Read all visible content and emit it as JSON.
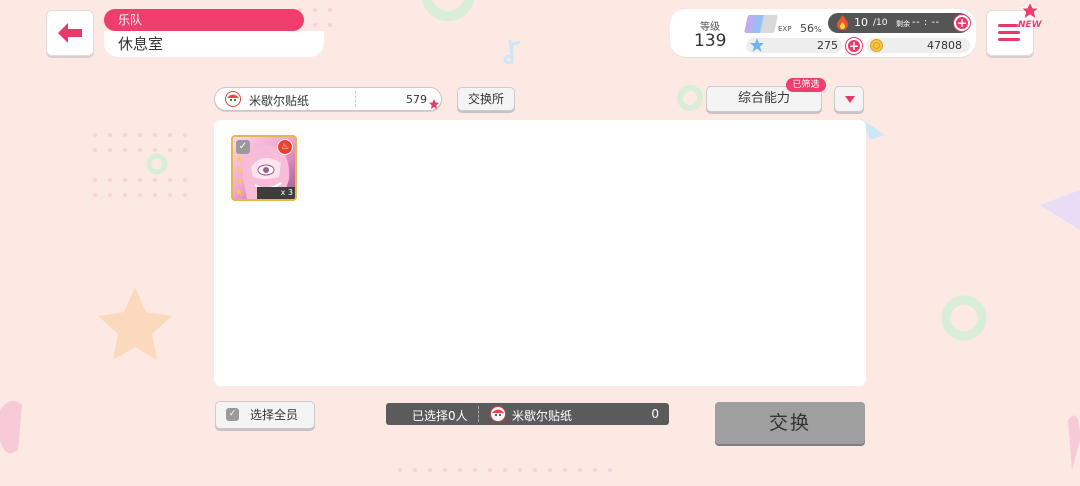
{
  "header": {
    "location_tag": "乐队",
    "location_name": "休息室"
  },
  "status": {
    "level_label": "等级",
    "level": "139",
    "exp_label": "EXP",
    "exp_percent": "56",
    "exp_unit": "%",
    "stamina_current": "10",
    "stamina_max": "/10",
    "stamina_remain_label": "剩余",
    "stamina_remain": "-- : --",
    "stars": "275",
    "coins": "47808"
  },
  "new_badge": "NEW",
  "toolbar": {
    "currency_name": "米歇尔贴纸",
    "currency_amount": "579",
    "exchange_shop_label": "交换所",
    "sort_label": "综合能力",
    "filtered_badge": "已筛选"
  },
  "cards": [
    {
      "count": "x 3",
      "attribute": "fire-icon"
    }
  ],
  "bottom": {
    "select_all_label": "选择全员",
    "selected_count": "已选择0人",
    "currency_name": "米歇尔贴纸",
    "currency_total": "0",
    "exchange_label": "交换"
  },
  "colors": {
    "accent": "#ef3e6d",
    "background": "#fde9e4",
    "disabled": "#9f9f9f"
  }
}
